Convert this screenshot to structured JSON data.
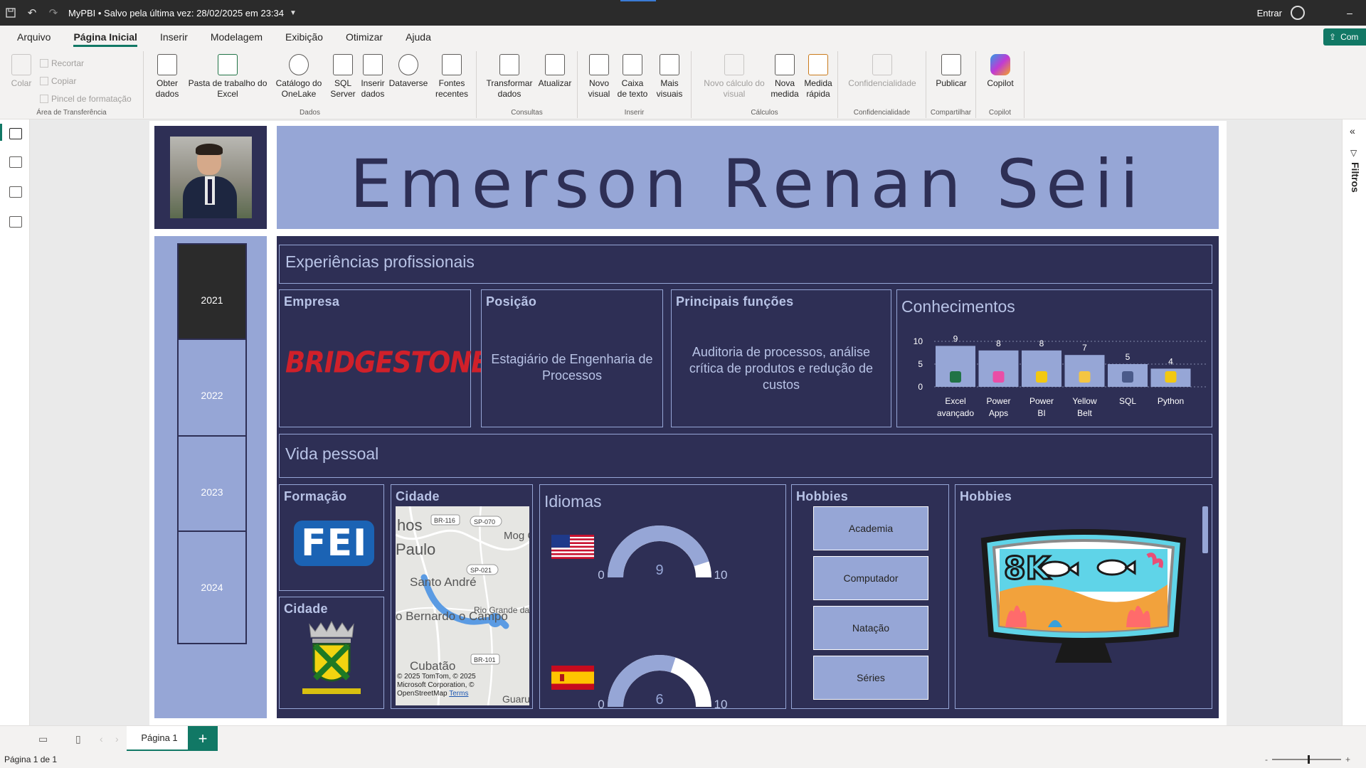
{
  "titlebar": {
    "title": "MyPBI • Salvo pela última vez: 28/02/2025 em 23:34",
    "signin": "Entrar",
    "min": "–"
  },
  "menu": {
    "items": [
      "Arquivo",
      "Página Inicial",
      "Inserir",
      "Modelagem",
      "Exibição",
      "Otimizar",
      "Ajuda"
    ],
    "active_index": 1,
    "share": "Com"
  },
  "ribbon": {
    "clipboard": {
      "paste": "Colar",
      "cut": "Recortar",
      "copy": "Copiar",
      "format_painter": "Pincel de formatação",
      "label": "Área de Transferência"
    },
    "data": {
      "get_data": "Obter dados",
      "excel": "Pasta de trabalho do Excel",
      "onelake": "Catálogo do OneLake",
      "sql": "SQL Server",
      "enter_data": "Inserir dados",
      "dataverse": "Dataverse",
      "recent": "Fontes recentes",
      "label": "Dados"
    },
    "queries": {
      "transform": "Transformar dados",
      "refresh": "Atualizar",
      "label": "Consultas"
    },
    "insert": {
      "new_visual": "Novo visual",
      "text_box": "Caixa de texto",
      "more_visuals": "Mais visuais",
      "label": "Inserir"
    },
    "calc": {
      "new_visual_calc": "Novo cálculo do visual",
      "new_measure": "Nova medida",
      "quick_measure": "Medida rápida",
      "label": "Cálculos"
    },
    "sensitivity": {
      "btn": "Confidencialidade",
      "label": "Confidencialidade"
    },
    "share": {
      "publish": "Publicar",
      "label": "Compartilhar"
    },
    "copilot": {
      "btn": "Copilot",
      "label": "Copilot"
    }
  },
  "filters": {
    "label": "Filtros"
  },
  "report": {
    "name": "Emerson Renan Seii",
    "years": [
      "2021",
      "2022",
      "2023",
      "2024"
    ],
    "selected_year": "2021",
    "experience": {
      "section": "Experiências profissionais",
      "company_label": "Empresa",
      "company_logo_text": "BRIDGESTONE",
      "position_label": "Posição",
      "position": "Estagiário de Engenharia de Processos",
      "functions_label": "Principais funções",
      "functions": "Auditoria de processos, análise crítica de produtos e redução de custos"
    },
    "personal": {
      "section": "Vida pessoal",
      "education_label": "Formação",
      "education_logo_text": "FEI",
      "city_label": "Cidade",
      "map_city_label": "Cidade",
      "map_labels": [
        "hos",
        "Paulo",
        "Santo André",
        "o Bernardo o Campo",
        "Cubatão",
        "Rio Grande da Serra",
        "Mog Cru",
        "Guarul",
        "BR-116",
        "SP-070",
        "SP-021",
        "BR-101"
      ],
      "map_attribution": "© 2025 TomTom, © 2025 Microsoft Corporation, © OpenStreetMap",
      "map_terms": "Terms",
      "languages_label": "Idiomas",
      "hobbies_label": "Hobbies",
      "hobbies": [
        "Academia",
        "Computador",
        "Natação",
        "Séries"
      ],
      "hobbies_image_label": "Hobbies",
      "hobbies_image_text": "8K"
    },
    "page": "Página 1",
    "status": "Página 1 de 1"
  },
  "colors": {
    "dark_navy": "#2e2f55",
    "periwinkle": "#96a6d6",
    "label_text": "#b8c3e6",
    "accent_green": "#117865"
  },
  "chart_data": [
    {
      "type": "bar",
      "title": "Conhecimentos",
      "categories": [
        "Excel avançado",
        "Power Apps",
        "Power BI",
        "Yellow Belt",
        "SQL",
        "Python"
      ],
      "values": [
        9,
        8,
        8,
        7,
        5,
        4
      ],
      "yticks": [
        0,
        5,
        10
      ],
      "ylim": [
        0,
        10
      ],
      "grid": true
    },
    {
      "type": "gauge",
      "title": "Idiomas",
      "gauges": [
        {
          "flag": "us-flag",
          "value": 9,
          "min": 0,
          "max": 10
        },
        {
          "flag": "spain-flag",
          "value": 6,
          "min": 0,
          "max": 10
        }
      ]
    }
  ]
}
